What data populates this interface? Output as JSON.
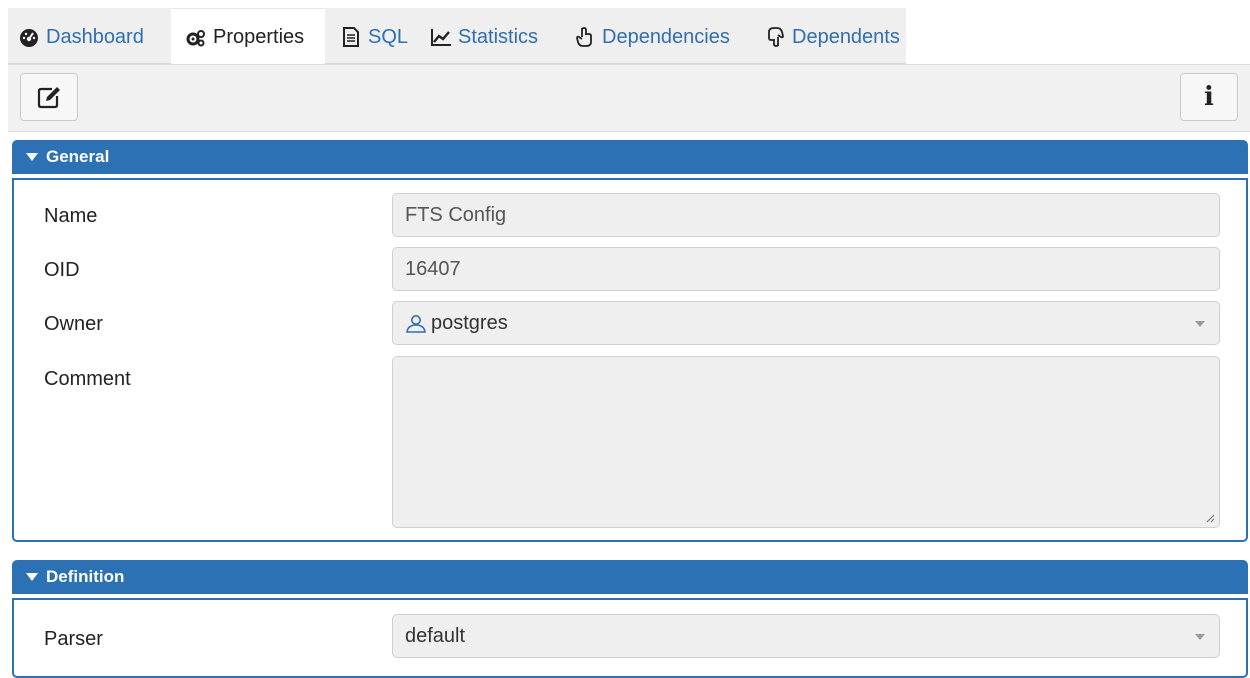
{
  "tabs": [
    {
      "label": "Dashboard",
      "icon": "dashboard-icon",
      "active": false
    },
    {
      "label": "Properties",
      "icon": "cogs-icon",
      "active": true
    },
    {
      "label": "SQL",
      "icon": "file-text-icon",
      "active": false
    },
    {
      "label": "Statistics",
      "icon": "line-chart-icon",
      "active": false
    },
    {
      "label": "Dependencies",
      "icon": "hand-up-icon",
      "active": false
    },
    {
      "label": "Dependents",
      "icon": "hand-down-icon",
      "active": false
    }
  ],
  "toolbar": {
    "edit_icon": "edit-icon",
    "info_label": "i"
  },
  "general": {
    "title": "General",
    "fields": {
      "name_label": "Name",
      "name_value": "FTS Config",
      "oid_label": "OID",
      "oid_value": "16407",
      "owner_label": "Owner",
      "owner_value": "postgres",
      "owner_icon": "user-icon",
      "comment_label": "Comment",
      "comment_value": ""
    }
  },
  "definition": {
    "title": "Definition",
    "parser_label": "Parser",
    "parser_value": "default"
  },
  "colors": {
    "accent": "#2b71b4",
    "link": "#2f6fb1",
    "field_bg": "#efefef"
  }
}
